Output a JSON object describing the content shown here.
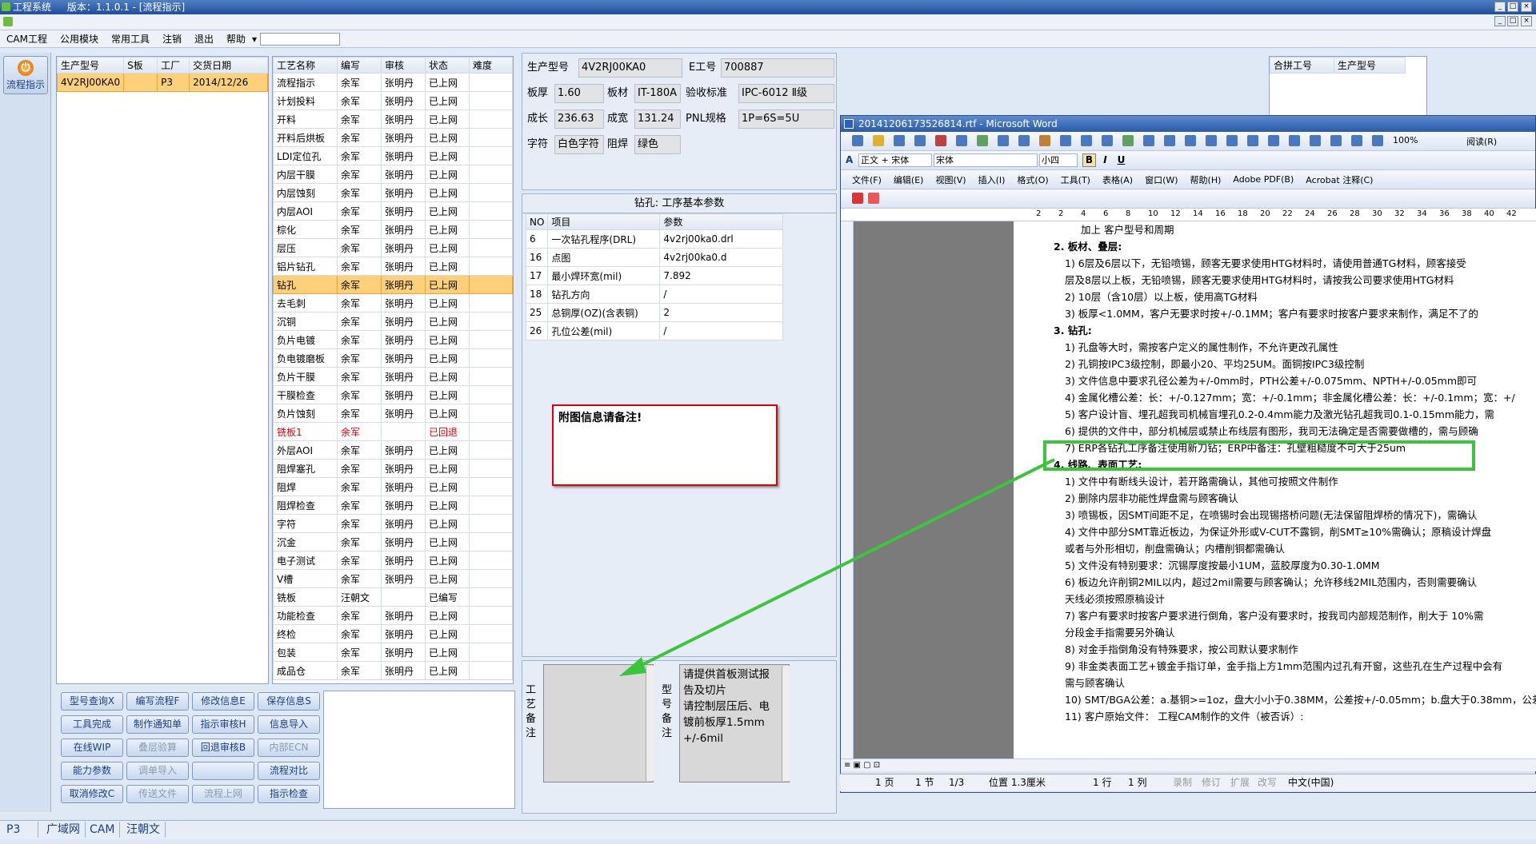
{
  "app": {
    "title": "工程系统",
    "version": "版本：1.1.0.1 - [流程指示]"
  },
  "menu": {
    "items": [
      "CAM工程",
      "公用模块",
      "常用工具",
      "注销",
      "退出",
      "帮助"
    ]
  },
  "leftnav": {
    "button_label": "流程指示"
  },
  "orders": {
    "headers": [
      "生产型号",
      "S板",
      "工厂",
      "交货日期"
    ],
    "rows": [
      [
        "4V2RJ00KA0",
        "",
        "P3",
        "2014/12/26"
      ]
    ]
  },
  "process": {
    "headers": [
      "工艺名称",
      "编写",
      "审核",
      "状态",
      "难度"
    ],
    "rows": [
      [
        "流程指示",
        "余军",
        "张明丹",
        "已上网"
      ],
      [
        "计划投料",
        "余军",
        "张明丹",
        "已上网"
      ],
      [
        "开料",
        "余军",
        "张明丹",
        "已上网"
      ],
      [
        "开料后烘板",
        "余军",
        "张明丹",
        "已上网"
      ],
      [
        "LDI定位孔",
        "余军",
        "张明丹",
        "已上网"
      ],
      [
        "内层干膜",
        "余军",
        "张明丹",
        "已上网"
      ],
      [
        "内层蚀刻",
        "余军",
        "张明丹",
        "已上网"
      ],
      [
        "内层AOI",
        "余军",
        "张明丹",
        "已上网"
      ],
      [
        "棕化",
        "余军",
        "张明丹",
        "已上网"
      ],
      [
        "层压",
        "余军",
        "张明丹",
        "已上网"
      ],
      [
        "铝片钻孔",
        "余军",
        "张明丹",
        "已上网"
      ],
      [
        "钻孔",
        "余军",
        "张明丹",
        "已上网"
      ],
      [
        "去毛刺",
        "余军",
        "张明丹",
        "已上网"
      ],
      [
        "沉铜",
        "余军",
        "张明丹",
        "已上网"
      ],
      [
        "负片电镀",
        "余军",
        "张明丹",
        "已上网"
      ],
      [
        "负电镀磨板",
        "余军",
        "张明丹",
        "已上网"
      ],
      [
        "负片干膜",
        "余军",
        "张明丹",
        "已上网"
      ],
      [
        "干膜检查",
        "余军",
        "张明丹",
        "已上网"
      ],
      [
        "负片蚀刻",
        "余军",
        "张明丹",
        "已上网"
      ],
      [
        "铣板1",
        "余军",
        "",
        "已回退"
      ],
      [
        "外层AOI",
        "余军",
        "张明丹",
        "已上网"
      ],
      [
        "阻焊塞孔",
        "余军",
        "张明丹",
        "已上网"
      ],
      [
        "阻焊",
        "余军",
        "张明丹",
        "已上网"
      ],
      [
        "阻焊检查",
        "余军",
        "张明丹",
        "已上网"
      ],
      [
        "字符",
        "余军",
        "张明丹",
        "已上网"
      ],
      [
        "沉金",
        "余军",
        "张明丹",
        "已上网"
      ],
      [
        "电子测试",
        "余军",
        "张明丹",
        "已上网"
      ],
      [
        "V槽",
        "余军",
        "张明丹",
        "已上网"
      ],
      [
        "铣板",
        "汪朝文",
        "",
        "已编写"
      ],
      [
        "功能检查",
        "余军",
        "张明丹",
        "已上网"
      ],
      [
        "终检",
        "余军",
        "张明丹",
        "已上网"
      ],
      [
        "包装",
        "余军",
        "张明丹",
        "已上网"
      ],
      [
        "成品仓",
        "余军",
        "张明丹",
        "已上网"
      ]
    ]
  },
  "buttons": [
    "型号查询X",
    "编写流程F",
    "修改信息E",
    "保存信息S",
    "工具完成",
    "制作通知单",
    "指示审核H",
    "信息导入",
    "在线WIP",
    "叠层验算",
    "回退审核B",
    "内部ECN",
    "能力参数",
    "调单导入",
    "",
    "流程对比",
    "取消修改C",
    "传送文件",
    "流程上网",
    "指示检查"
  ],
  "info": {
    "model_label": "生产型号",
    "model": "4V2RJ00KA0",
    "eno_label": "E工号",
    "eno": "700887",
    "thick_label": "板厚",
    "thick": "1.60",
    "mat_label": "板材",
    "mat": "IT-180A",
    "std_label": "验收标准",
    "std": "IPC-6012 Ⅱ级",
    "len_label": "成长",
    "len": "236.63",
    "wid_label": "成宽",
    "wid": "131.24",
    "pnl_label": "PNL规格",
    "pnl": "1P=6S=5U",
    "char_label": "字符",
    "char": "白色字符",
    "mask_label": "阻焊",
    "mask": "绿色"
  },
  "merge": {
    "headers": [
      "合拼工号",
      "生产型号"
    ]
  },
  "drill": {
    "title": "钻孔: 工序基本参数",
    "headers": [
      "NO",
      "项目",
      "参数"
    ],
    "rows": [
      [
        "6",
        "一次钻孔程序(DRL)",
        "4v2rj00ka0.drl"
      ],
      [
        "16",
        "点图",
        "4v2rj00ka0.d"
      ],
      [
        "17",
        "最小焊环宽(mil)",
        "7.892"
      ],
      [
        "18",
        "钻孔方向",
        "/"
      ],
      [
        "25",
        "总铜厚(OZ)(含表铜)",
        "2"
      ],
      [
        "26",
        "孔位公差(mil)",
        "/"
      ]
    ]
  },
  "note_box": "附图信息请备注!",
  "remarks": {
    "process_label": "工艺备注",
    "model_label": "型号备注",
    "model_text": "请提供首板测试报告及切片\n请控制层压后、电镀前板厚1.5mm +/-6mil"
  },
  "word": {
    "title": "20141206173526814.rtf - Microsoft Word",
    "zoom": "100%",
    "read_label": "阅读(R)",
    "style": "正文 + 宋体",
    "font": "宋体",
    "size": "小四",
    "menu": [
      "文件(F)",
      "编辑(E)",
      "视图(V)",
      "插入(I)",
      "格式(O)",
      "工具(T)",
      "表格(A)",
      "窗口(W)",
      "帮助(H)",
      "Adobe PDF(B)",
      "Acrobat 注释(C)"
    ],
    "ruler": [
      "2",
      "2",
      "4",
      "6",
      "8",
      "10",
      "12",
      "14",
      "16",
      "18",
      "20",
      "22",
      "24",
      "26",
      "28",
      "30",
      "32",
      "34",
      "36",
      "38",
      "40",
      "42"
    ],
    "lines": [
      "加上 客户型号和周期",
      "2.  板材、叠层:",
      "1) 6层及6层以下，无铅喷锡，顾客无要求使用HTG材料时，请使用普通TG材料，顾客接受",
      "   层及8层以上板，无铅喷锡，顾客无要求使用HTG材料时，请按我公司要求使用HTG材料",
      "2) 10层（含10层）以上板，使用高TG材料",
      "3) 板厚<1.0MM，客户无要求时按+/-0.1MM；客户有要求时按客户要求来制作，满足不了的",
      "3.  钻孔:",
      "1) 孔盘等大时，需按客户定义的属性制作，不允许更改孔属性",
      "2) 孔铜按IPC3级控制，即最小20、平均25UM。面铜按IPC3级控制",
      "3) 文件信息中要求孔径公差为+/-0mm时，PTH公差+/-0.075mm、NPTH+/-0.05mm即可",
      "4) 金属化槽公差：长：+/-0.127mm；宽：+/-0.1mm；非金属化槽公差：长：+/-0.1mm；宽：+/",
      "5) 客户设计盲、埋孔超我司机械盲埋孔0.2-0.4mm能力及激光钻孔超我司0.1-0.15mm能力，需",
      "6) 提供的文件中，部分机械层或禁止布线层有图形，我司无法确定是否需要做槽的，需与顾确",
      "7) ERP各钻孔工序备注使用新刀钻；ERP中备注：孔壁粗糙度不可大于25um",
      "4.  线路、表面工艺:",
      "1) 文件中有断线头设计，若开路需确认，其他可按照文件制作",
      "2) 删除内层非功能性焊盘需与顾客确认",
      "3) 喷锡板，因SMT间距不足，在喷锡时会出现锡搭桥问题(无法保留阻焊桥的情况下)，需确认",
      "4) 文件中部分SMT靠近板边，为保证外形或V-CUT不露铜，削SMT≥10%需确认；原稿设计焊盘",
      "   或者与外形相切，削盘需确认；内槽削铜都需确认",
      "5) 文件没有特别要求：沉锡厚度按最小1UM，蓝胶厚度为0.30-1.0MM",
      "6) 板边允许削铜2MIL以内，超过2mil需要与顾客确认；允许移线2MIL范围内，否则需要确认",
      "   天线必须按照原稿设计",
      "7) 客户有要求时按客户要求进行倒角，客户没有要求时，按我司内部规范制作，削大于 10%需",
      "   分段金手指需要另外确认",
      "8) 对金手指倒角没有特殊要求，按公司默认要求制作",
      "9) 非金类表面工艺+镀金手指订单，金手指上方1mm范围内过孔有开窗，这些孔在生产过程中会有",
      "   需与顾客确认",
      "10) SMT/BGA公差：a.基铜>=1oz，盘大小小于0.38MM，公差按+/-0.05mm；b.盘大于0.38mm，公差",
      "11)            客户原始文件：                    工程CAM制作的文件（被否诉）:"
    ],
    "status": [
      "1 页",
      "1 节",
      "1/3",
      "位置 1.3厘米",
      "1 行",
      "1 列",
      "录制",
      "修订",
      "扩展",
      "改写",
      "中文(中国)"
    ]
  },
  "taskbar": [
    "P3",
    "广域网",
    "CAM",
    "汪朝文"
  ],
  "colors": {
    "highlight_row": "#ffd07a",
    "red_box": "#d8000c",
    "green_box": "#3cc43c",
    "title_blue": "#2a5aa8"
  }
}
